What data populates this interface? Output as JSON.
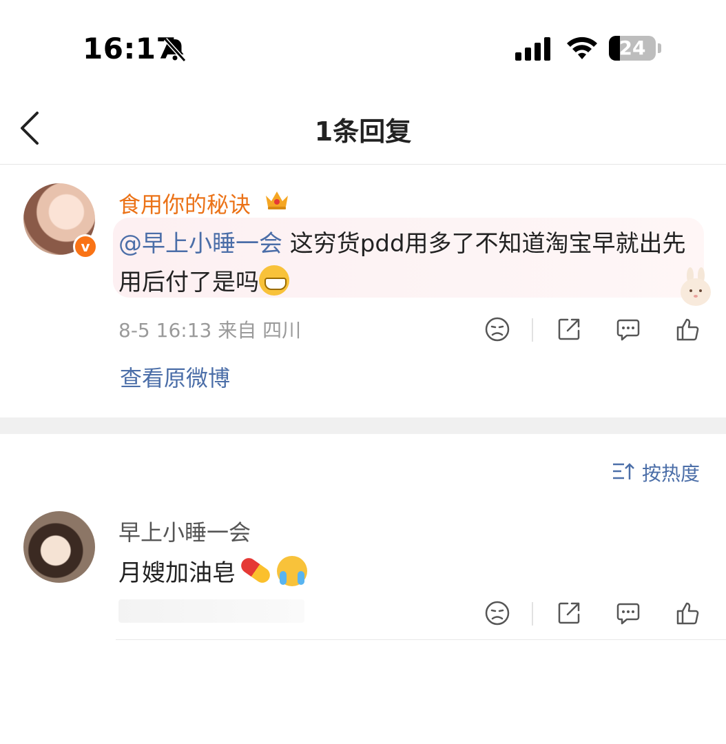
{
  "status_bar": {
    "time": "16:17",
    "battery": "24",
    "battery_level_pct": 24
  },
  "nav": {
    "title": "1条回复"
  },
  "comment": {
    "username": "食用你的秘诀",
    "mention": "@早上小睡一会",
    "text": " 这穷货pdd用多了不知道淘宝早就出先用后付了是吗",
    "meta": "8-5 16:13  来自 四川",
    "view_original": "查看原微博"
  },
  "sort": {
    "label": "按热度"
  },
  "reply": {
    "username": "早上小睡一会",
    "text": "月嫂加油皂"
  },
  "icons": [
    "bell-slash-icon",
    "signal-icon",
    "wifi-icon",
    "battery-icon",
    "back-chevron-icon",
    "crown-icon",
    "grin-emoji",
    "dislike-face-icon",
    "share-icon",
    "comment-icon",
    "like-icon",
    "sort-icon",
    "pill-emoji",
    "crying-emoji"
  ],
  "colors": {
    "accent_link": "#4b6ea8",
    "username_orange": "#eb7217",
    "vip_badge": "#f97316"
  }
}
